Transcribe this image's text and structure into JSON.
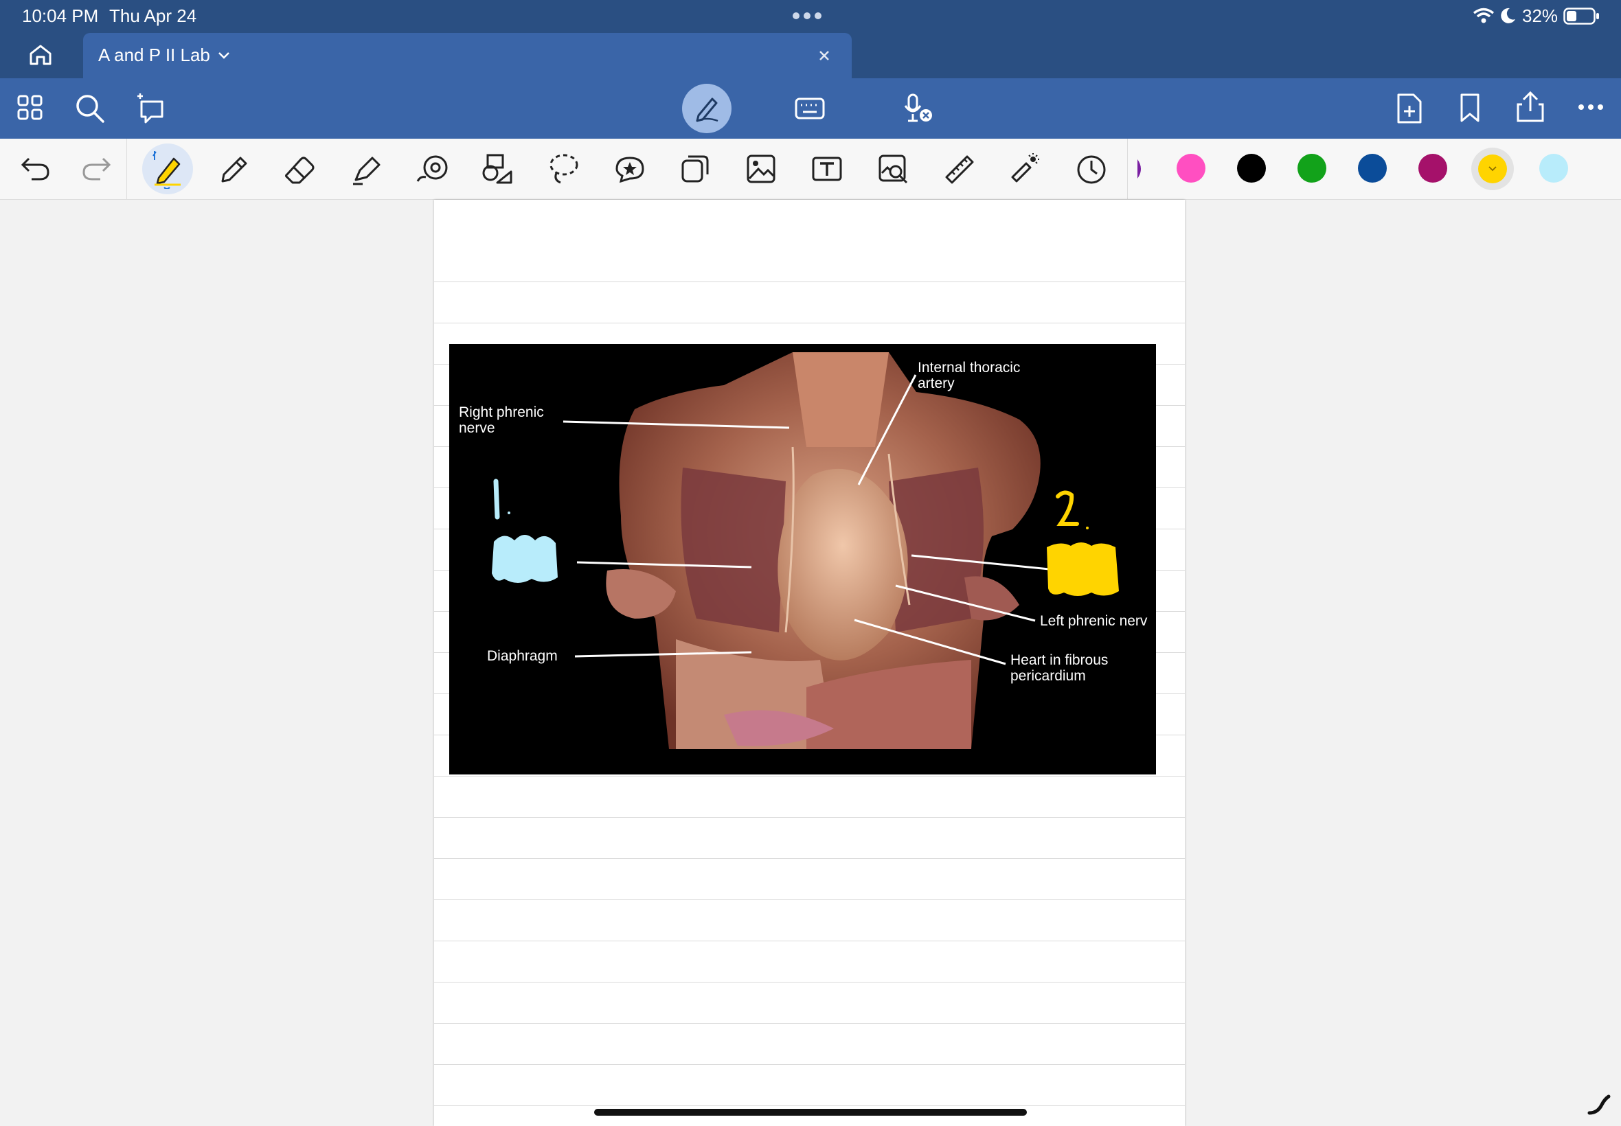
{
  "status_bar": {
    "time": "10:04 PM",
    "date": "Thu Apr 24",
    "battery": "32%"
  },
  "tab": {
    "title": "A and P II Lab",
    "icons": [
      "home-icon",
      "chevron-down-icon",
      "close-icon"
    ]
  },
  "top_toolbar": {
    "left_icons": [
      "grid-icon",
      "search-icon",
      "lasso-select-icon"
    ],
    "center_icons": [
      "pen-mode-icon",
      "keyboard-icon",
      "microphone-off-icon"
    ],
    "right_icons": [
      "add-page-icon",
      "bookmark-icon",
      "share-icon",
      "more-icon"
    ]
  },
  "tool_toolbar": {
    "tools": [
      "undo-icon",
      "redo-icon",
      "pen-tool-icon",
      "pencil-icon",
      "eraser-icon",
      "highlighter-icon",
      "shape-icon",
      "shapes-icon",
      "lasso-icon",
      "sticker-icon",
      "sticky-note-icon",
      "image-icon",
      "text-box-icon",
      "image-search-icon",
      "ruler-icon",
      "laser-pointer-icon",
      "clock-icon"
    ],
    "active_tool": "pen-tool-icon",
    "colors": [
      "#ff4fc1",
      "#000000",
      "#12a21a",
      "#0b4c99",
      "#a5116a",
      "#ffd400",
      "#b8ecfb"
    ],
    "selected_color": "#ffd400"
  },
  "figure": {
    "labels": {
      "internal_thoracic": "Internal thoracic\nartery",
      "right_phrenic": "Right phrenic\nnerve",
      "diaphragm": "Diaphragm",
      "left_phrenic": "Left phrenic nerv",
      "heart": "Heart in fibrous\npericardium"
    },
    "annotations": {
      "mark_1": "1.",
      "mark_2": "2."
    }
  }
}
